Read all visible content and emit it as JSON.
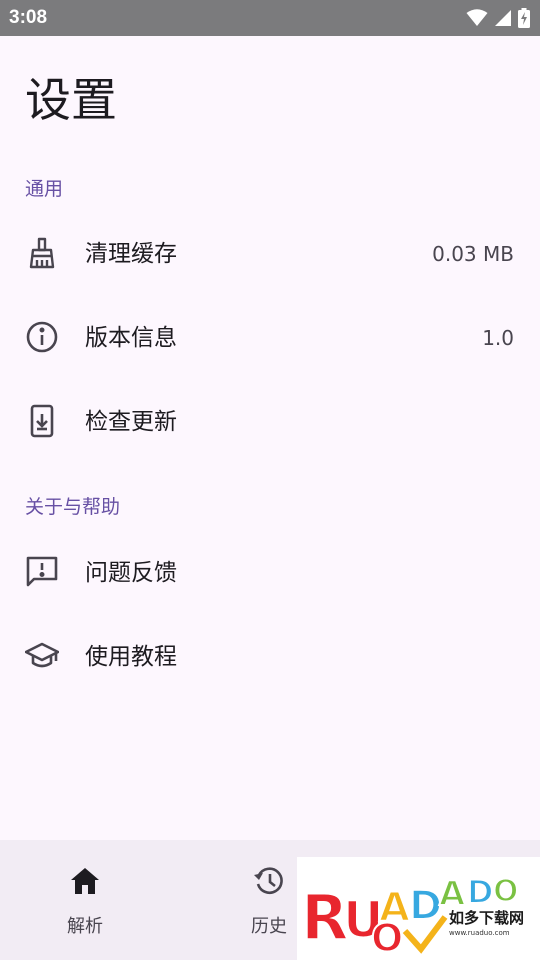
{
  "status_bar": {
    "time": "3:08"
  },
  "page": {
    "title": "设置"
  },
  "sections": [
    {
      "header": "通用"
    },
    {
      "header": "关于与帮助"
    }
  ],
  "rows": {
    "clear_cache": {
      "label": "清理缓存",
      "value": "0.03 MB",
      "icon": "broom-icon"
    },
    "version": {
      "label": "版本信息",
      "value": "1.0",
      "icon": "info-icon"
    },
    "update": {
      "label": "检查更新",
      "icon": "system-update-icon"
    },
    "feedback": {
      "label": "问题反馈",
      "icon": "feedback-icon"
    },
    "tutorial": {
      "label": "使用教程",
      "icon": "school-icon"
    }
  },
  "bottom_nav": {
    "parse": {
      "label": "解析",
      "icon": "home-icon"
    },
    "history": {
      "label": "历史",
      "icon": "history-icon"
    }
  },
  "watermark": {
    "logo": "RUANPADAO",
    "text": "如多下载网",
    "url": "www.ruaduo.com"
  },
  "colors": {
    "accent": "#6750a4",
    "background": "#fdf7fe",
    "nav_background": "#f2ecf4",
    "status_bar": "#7b7b7d"
  }
}
